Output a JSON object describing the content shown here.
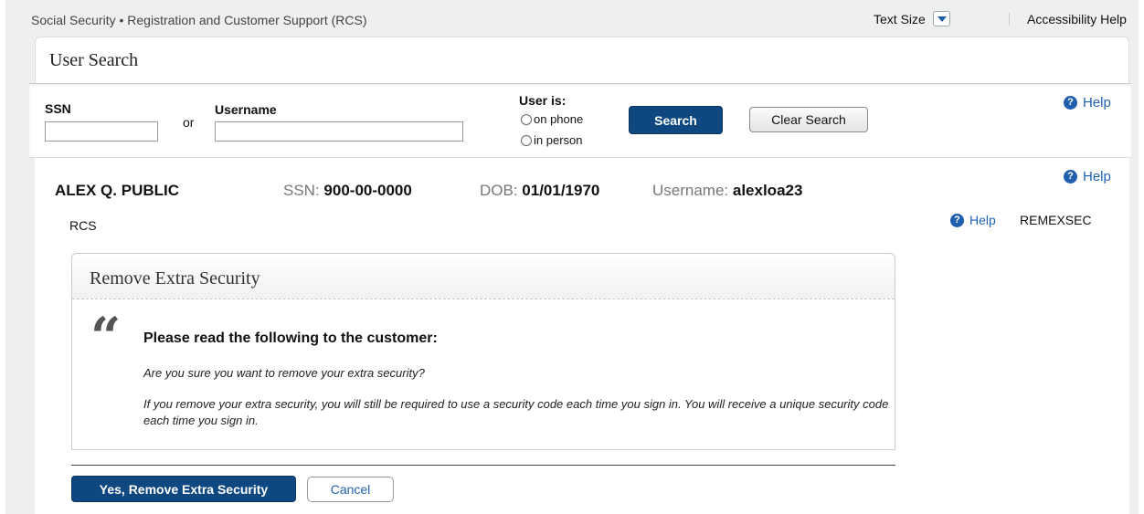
{
  "topbar": {
    "app_title": "Social Security • Registration and Customer Support (RCS)",
    "text_size_label": "Text Size",
    "accessibility_help": "Accessibility Help"
  },
  "user_search": {
    "title": "User Search",
    "ssn_label": "SSN",
    "ssn_value": "",
    "or_text": "or",
    "username_label": "Username",
    "username_value": "",
    "user_is_label": "User is:",
    "options": [
      "on phone",
      "in person"
    ],
    "search_button": "Search",
    "clear_button": "Clear Search",
    "help": "Help"
  },
  "customer": {
    "name": "ALEX Q. PUBLIC",
    "ssn_label": "SSN:",
    "ssn": "900-00-0000",
    "dob_label": "DOB:",
    "dob": "01/01/1970",
    "username_label": "Username:",
    "username": "alexloa23",
    "help": "Help",
    "rcs": "RCS",
    "section_help": "Help",
    "screen_code": "REMEXSEC"
  },
  "panel": {
    "title": "Remove Extra Security",
    "quote_glyph": "“",
    "heading": "Please read the following to the customer:",
    "line1": "Are you sure you want to remove your extra security?",
    "line2": "If you remove your extra security, you will still be required to use a security code each time you sign in. You will receive a unique security code each time you sign in."
  },
  "actions": {
    "confirm": "Yes, Remove Extra Security",
    "cancel": "Cancel"
  },
  "colors": {
    "primary": "#0f4780",
    "link": "#1f63b4"
  }
}
